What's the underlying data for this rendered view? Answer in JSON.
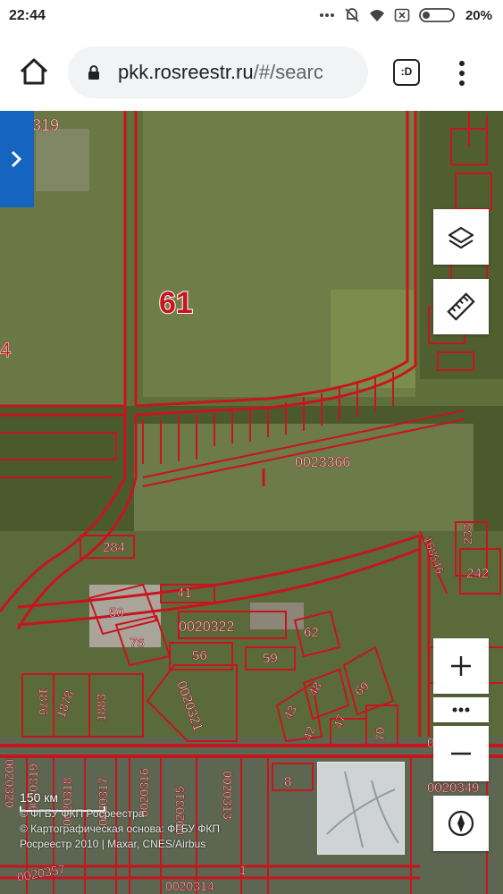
{
  "status_bar": {
    "time": "22:44",
    "battery": "20%",
    "icons": [
      "more-icon",
      "mute-icon",
      "wifi-icon",
      "close-box-icon",
      "battery-icon"
    ]
  },
  "browser": {
    "url_host": "pkk.rosreestr.ru",
    "url_rest": "/#/searc",
    "tabs_label": ":D"
  },
  "map": {
    "labels": {
      "field": "61",
      "top_left": "319",
      "left_edge": "4",
      "parcel_a": "0023366",
      "p284": "284",
      "p233": "233",
      "p242": "242",
      "p168546": "168546",
      "p41": "41",
      "p50": "50",
      "p76": "76",
      "parcel_b": "0020322",
      "p62": "62",
      "p56": "56",
      "p59": "59",
      "p1876": "1876",
      "p1878": "1878",
      "p1883": "1883",
      "parcel_c": "0020321",
      "p43": "43",
      "p48": "48",
      "p69": "69",
      "p47": "47",
      "p42": "42",
      "p70": "70",
      "parcel_d": "0020320",
      "parcel_e": "0020319",
      "parcel_f": "0020318",
      "parcel_g": "0020317",
      "parcel_h": "0020316",
      "parcel_i": "0020315",
      "parcel_j": "0020313",
      "p8": "8",
      "parcel_k": "0020349",
      "parcel_l": "00203",
      "parcel_m": "0020357",
      "parcel_n": "0020314",
      "p1": "1"
    },
    "scale_label": "150 км",
    "copyright_lines": [
      "© ФГБУ ФКП Росреестра",
      "© Картографическая основа: ФГБУ ФКП",
      "Росреестр 2010 | Maxar, CNES/Airbus"
    ]
  },
  "colors": {
    "parcel_border": "#c8141e",
    "sidebar_button": "#1565c0",
    "satellite_field": "#5f6f3a"
  }
}
